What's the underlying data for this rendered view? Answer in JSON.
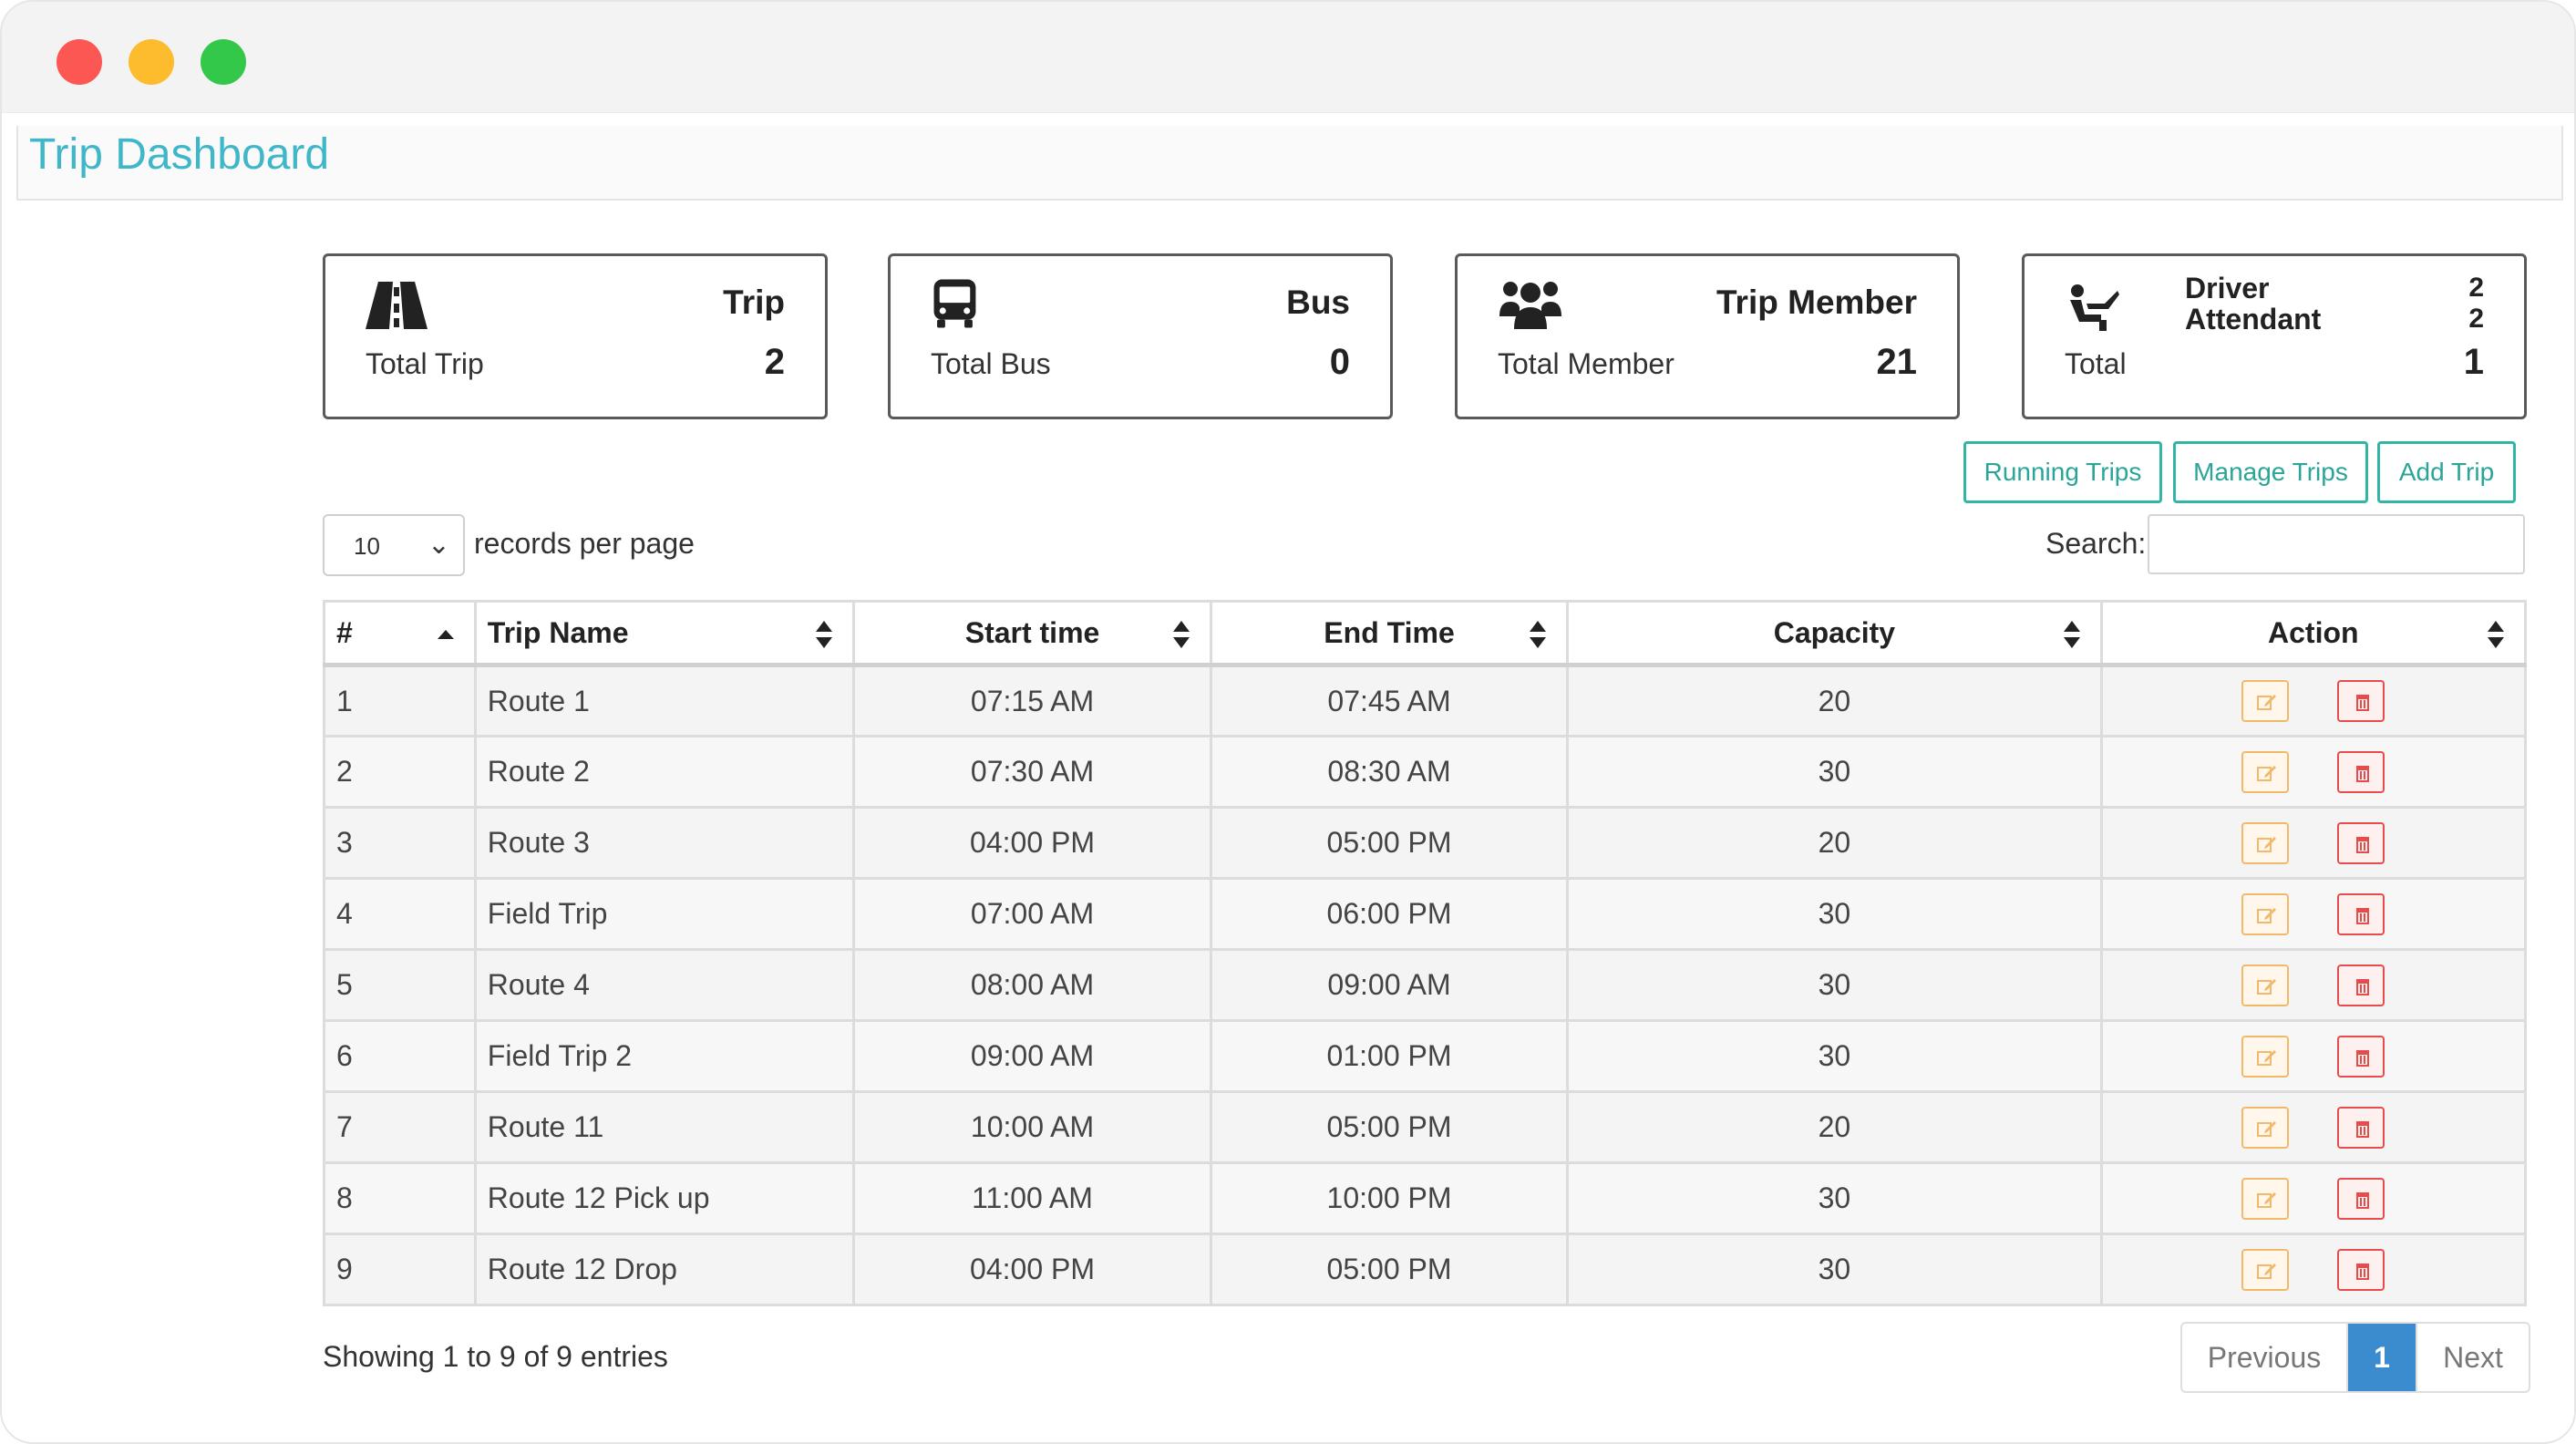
{
  "page": {
    "title": "Trip Dashboard"
  },
  "cards": [
    {
      "icon": "road-icon",
      "title": "Trip",
      "label": "Total Trip",
      "value": "2"
    },
    {
      "icon": "bus-icon",
      "title": "Bus",
      "label": "Total Bus",
      "value": "0"
    },
    {
      "icon": "users-icon",
      "title": "Trip Member",
      "label": "Total Member",
      "value": "21"
    },
    {
      "icon": "driver-seat-icon",
      "rows": [
        {
          "label": "Driver",
          "value": "2"
        },
        {
          "label": "Attendant",
          "value": "2"
        }
      ],
      "label": "Total",
      "value": "1"
    }
  ],
  "buttons": {
    "running": "Running Trips",
    "manage": "Manage Trips",
    "add": "Add Trip"
  },
  "length": {
    "value": "10",
    "label": "records per page"
  },
  "search": {
    "label": "Search:",
    "placeholder": ""
  },
  "table": {
    "headers": [
      "#",
      "Trip Name",
      "Start time",
      "End Time",
      "Capacity",
      "Action"
    ],
    "rows": [
      {
        "num": "1",
        "name": "Route 1",
        "start": "07:15 AM",
        "end": "07:45 AM",
        "capacity": "20"
      },
      {
        "num": "2",
        "name": "Route 2",
        "start": "07:30 AM",
        "end": "08:30 AM",
        "capacity": "30"
      },
      {
        "num": "3",
        "name": "Route 3",
        "start": "04:00 PM",
        "end": "05:00 PM",
        "capacity": "20"
      },
      {
        "num": "4",
        "name": "Field Trip",
        "start": "07:00 AM",
        "end": "06:00 PM",
        "capacity": "30"
      },
      {
        "num": "5",
        "name": "Route 4",
        "start": "08:00 AM",
        "end": "09:00 AM",
        "capacity": "30"
      },
      {
        "num": "6",
        "name": "Field Trip 2",
        "start": "09:00 AM",
        "end": "01:00 PM",
        "capacity": "30"
      },
      {
        "num": "7",
        "name": "Route 11",
        "start": "10:00 AM",
        "end": "05:00 PM",
        "capacity": "20"
      },
      {
        "num": "8",
        "name": "Route 12 Pick up",
        "start": "11:00 AM",
        "end": "10:00 PM",
        "capacity": "30"
      },
      {
        "num": "9",
        "name": "Route 12 Drop",
        "start": "04:00 PM",
        "end": "05:00 PM",
        "capacity": "30"
      }
    ]
  },
  "footer": {
    "info": "Showing 1 to 9 of 9 entries",
    "prev": "Previous",
    "current": "1",
    "next": "Next"
  },
  "colors": {
    "accent": "#3fb7c9",
    "button": "#33b5a5",
    "edit": "#f2b96b",
    "delete": "#e64c4c",
    "pager": "#3a8ccf"
  }
}
